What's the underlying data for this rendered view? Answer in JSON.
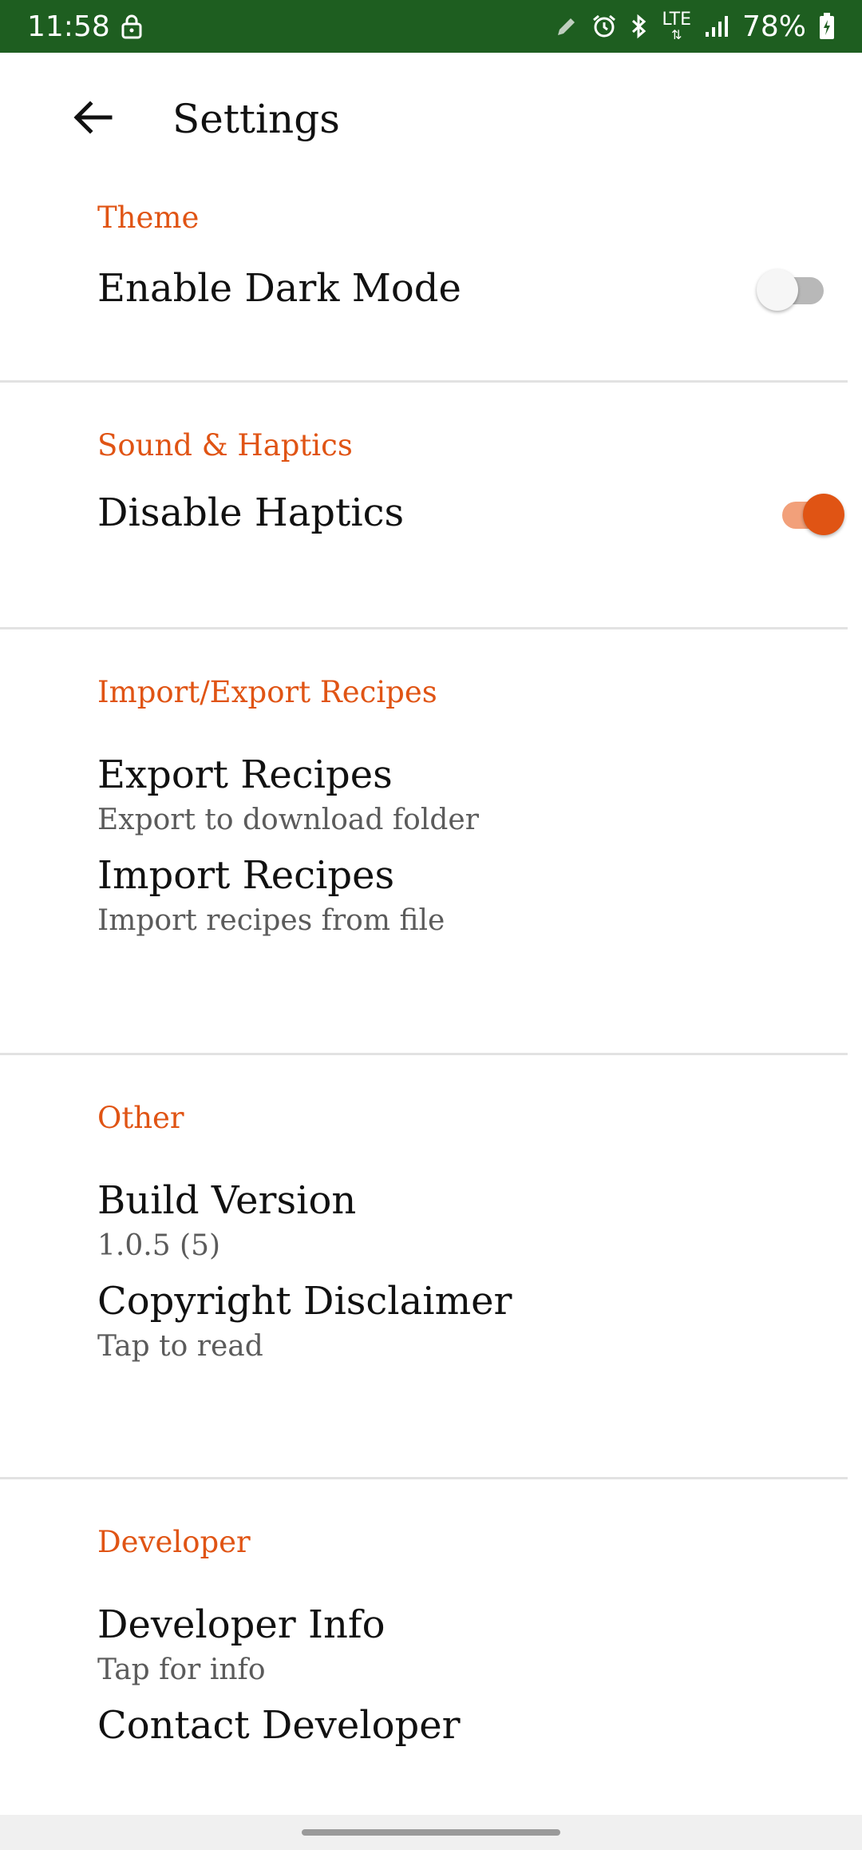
{
  "status_bar": {
    "time": "11:58",
    "network": "LTE",
    "battery": "78%",
    "icons": [
      "lock-icon",
      "pencil-icon",
      "alarm-icon",
      "bluetooth-icon",
      "lte-icon",
      "signal-icon",
      "battery-icon"
    ]
  },
  "app_bar": {
    "title": "Settings",
    "back_icon": "arrow-left-icon"
  },
  "sections": {
    "theme": {
      "header": "Theme",
      "dark_mode": {
        "title": "Enable Dark Mode",
        "enabled": false
      }
    },
    "sound": {
      "header": "Sound & Haptics",
      "haptics": {
        "title": "Disable Haptics",
        "enabled": true
      }
    },
    "import_export": {
      "header": "Import/Export Recipes",
      "export": {
        "title": "Export Recipes",
        "summary": "Export to download folder"
      },
      "import": {
        "title": "Import Recipes",
        "summary": "Import recipes from file"
      }
    },
    "other": {
      "header": "Other",
      "build": {
        "title": "Build Version",
        "summary": "1.0.5 (5)"
      },
      "copyright": {
        "title": "Copyright Disclaimer",
        "summary": "Tap to read"
      }
    },
    "developer": {
      "header": "Developer",
      "info": {
        "title": "Developer Info",
        "summary": "Tap for info"
      },
      "contact": {
        "title": "Contact Developer"
      }
    }
  },
  "colors": {
    "status_bar_bg": "#1e5e20",
    "accent": "#e05414",
    "accent_track": "#f2a07a",
    "switch_off_track": "#b8b8b8",
    "switch_off_thumb": "#f6f6f6",
    "divider": "#e2e2e2"
  }
}
